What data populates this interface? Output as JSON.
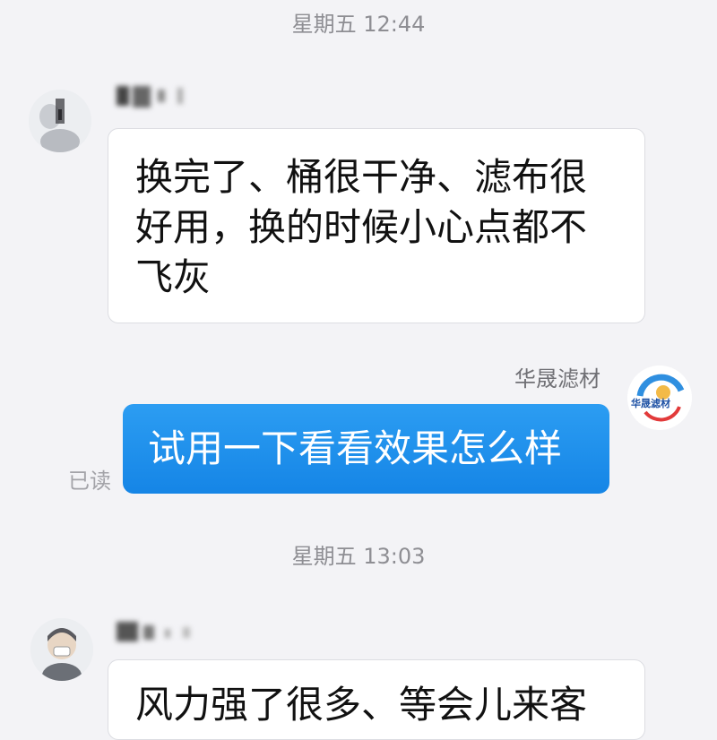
{
  "chat": {
    "timestamp_1": "星期五 12:44",
    "message_1": {
      "text": "换完了、桶很干净、滤布很好用，换的时候小心点都不飞灰"
    },
    "outgoing": {
      "sender": "华晟滤材",
      "avatar_logo_text": "华晟滤材",
      "text": "试用一下看看效果怎么样",
      "status": "已读"
    },
    "timestamp_2": "星期五 13:03",
    "message_2": {
      "text": "风力强了很多、等会儿来客"
    }
  },
  "colors": {
    "background": "#f3f3f6",
    "outgoing_bubble": "#1e90ee",
    "incoming_bubble": "#ffffff",
    "meta_text": "#8e8e93"
  }
}
